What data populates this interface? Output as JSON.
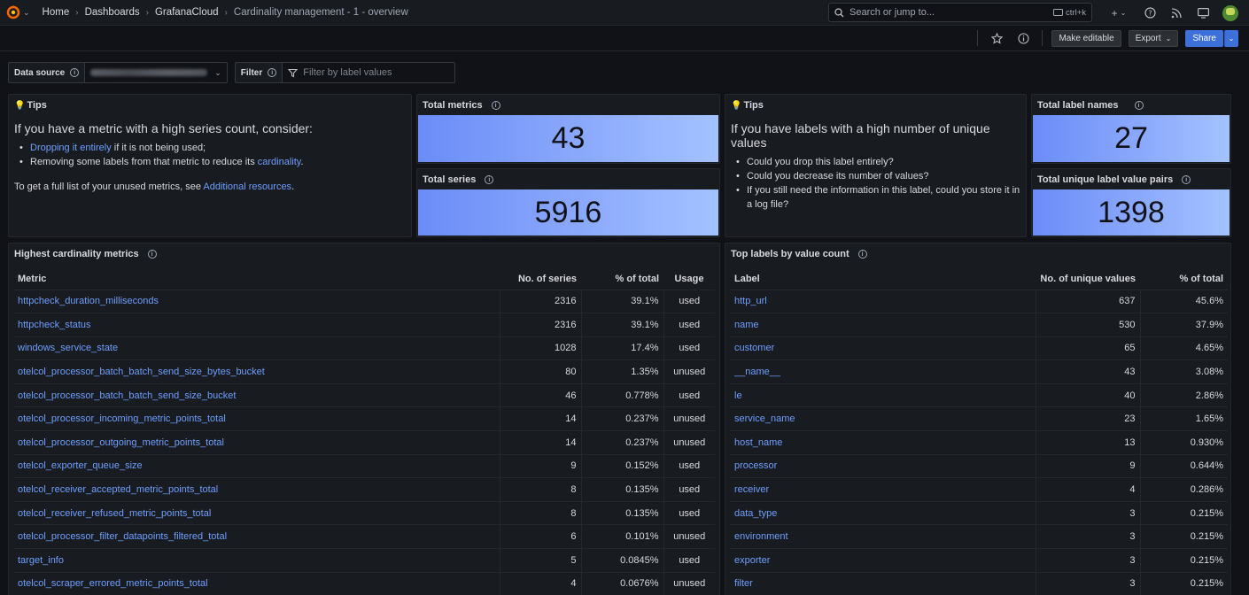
{
  "breadcrumbs": [
    "Home",
    "Dashboards",
    "GrafanaCloud",
    "Cardinality management - 1 - overview"
  ],
  "search": {
    "placeholder": "Search or jump to...",
    "shortcut": "ctrl+k"
  },
  "toolbar": {
    "make_editable": "Make editable",
    "export": "Export",
    "share": "Share"
  },
  "variables": {
    "datasource_label": "Data source",
    "filter_label": "Filter",
    "filter_placeholder": "Filter by label values"
  },
  "tips_left": {
    "title": "Tips",
    "heading": "If you have a metric with a high series count, consider:",
    "item1_link": "Dropping it entirely",
    "item1_rest": " if it is not being used;",
    "item2_text": "Removing some labels from that metric to reduce its ",
    "item2_link": "cardinality",
    "item2_end": ".",
    "foot_text": "To get a full list of your unused metrics, see ",
    "foot_link": "Additional resources",
    "foot_end": "."
  },
  "stats": {
    "total_metrics": {
      "title": "Total metrics",
      "value": "43"
    },
    "total_series": {
      "title": "Total series",
      "value": "5916"
    },
    "total_label_names": {
      "title": "Total label names",
      "value": "27"
    },
    "total_pairs": {
      "title": "Total unique label value pairs",
      "value": "1398"
    }
  },
  "tips_right": {
    "title": "Tips",
    "heading": "If you have labels with a high number of unique values",
    "items": [
      "Could you drop this label entirely?",
      "Could you decrease its number of values?",
      "If you still need the information in this label, could you store it in a log file?"
    ]
  },
  "metrics_table": {
    "title": "Highest cardinality metrics",
    "headers": [
      "Metric",
      "No. of series",
      "% of total",
      "Usage"
    ],
    "rows": [
      [
        "httpcheck_duration_milliseconds",
        "2316",
        "39.1%",
        "used"
      ],
      [
        "httpcheck_status",
        "2316",
        "39.1%",
        "used"
      ],
      [
        "windows_service_state",
        "1028",
        "17.4%",
        "used"
      ],
      [
        "otelcol_processor_batch_batch_send_size_bytes_bucket",
        "80",
        "1.35%",
        "unused"
      ],
      [
        "otelcol_processor_batch_batch_send_size_bucket",
        "46",
        "0.778%",
        "used"
      ],
      [
        "otelcol_processor_incoming_metric_points_total",
        "14",
        "0.237%",
        "unused"
      ],
      [
        "otelcol_processor_outgoing_metric_points_total",
        "14",
        "0.237%",
        "unused"
      ],
      [
        "otelcol_exporter_queue_size",
        "9",
        "0.152%",
        "used"
      ],
      [
        "otelcol_receiver_accepted_metric_points_total",
        "8",
        "0.135%",
        "used"
      ],
      [
        "otelcol_receiver_refused_metric_points_total",
        "8",
        "0.135%",
        "used"
      ],
      [
        "otelcol_processor_filter_datapoints_filtered_total",
        "6",
        "0.101%",
        "unused"
      ],
      [
        "target_info",
        "5",
        "0.0845%",
        "used"
      ],
      [
        "otelcol_scraper_errored_metric_points_total",
        "4",
        "0.0676%",
        "unused"
      ]
    ]
  },
  "labels_table": {
    "title": "Top labels by value count",
    "headers": [
      "Label",
      "No. of unique values",
      "% of total"
    ],
    "rows": [
      [
        "http_url",
        "637",
        "45.6%"
      ],
      [
        "name",
        "530",
        "37.9%"
      ],
      [
        "customer",
        "65",
        "4.65%"
      ],
      [
        "__name__",
        "43",
        "3.08%"
      ],
      [
        "le",
        "40",
        "2.86%"
      ],
      [
        "service_name",
        "23",
        "1.65%"
      ],
      [
        "host_name",
        "13",
        "0.930%"
      ],
      [
        "processor",
        "9",
        "0.644%"
      ],
      [
        "receiver",
        "4",
        "0.286%"
      ],
      [
        "data_type",
        "3",
        "0.215%"
      ],
      [
        "environment",
        "3",
        "0.215%"
      ],
      [
        "exporter",
        "3",
        "0.215%"
      ],
      [
        "filter",
        "3",
        "0.215%"
      ]
    ]
  }
}
